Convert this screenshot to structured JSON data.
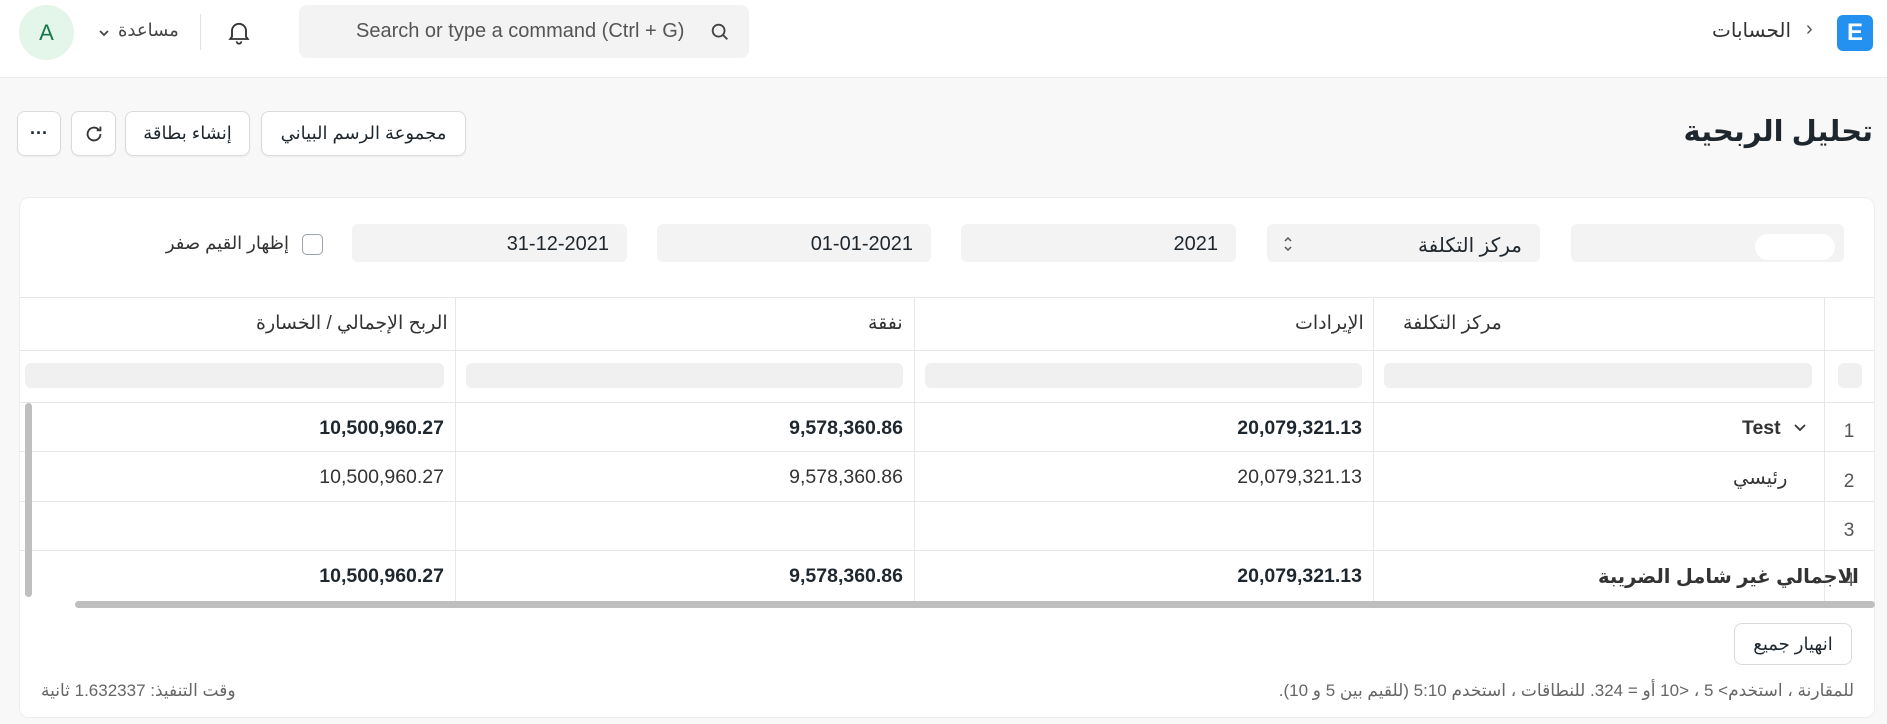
{
  "navbar": {
    "logo_letter": "E",
    "breadcrumb": "الحسابات",
    "search_placeholder": "Search or type a command (Ctrl + G)",
    "help_label": "مساعدة",
    "avatar_letter": "A"
  },
  "page": {
    "title": "تحليل الربحية",
    "buttons": {
      "chart_group": "مجموعة الرسم البياني",
      "create_card": "إنشاء بطاقة",
      "more": "···"
    }
  },
  "filters": {
    "based_on": "مركز التكلفة",
    "fiscal_year": "2021",
    "from_date": "01-01-2021",
    "to_date": "31-12-2021",
    "show_zero_label": "إظهار القيم صفر"
  },
  "table": {
    "columns": [
      "مركز التكلفة",
      "الإيرادات",
      "نفقة",
      "الربح الإجمالي / الخسارة"
    ],
    "rows": [
      {
        "num": "1",
        "cost_center": "Test",
        "income": "20,079,321.13",
        "expense": "9,578,360.86",
        "profit": "10,500,960.27",
        "bold": true
      },
      {
        "num": "2",
        "cost_center": "رئيسي",
        "income": "20,079,321.13",
        "expense": "9,578,360.86",
        "profit": "10,500,960.27",
        "bold": false
      },
      {
        "num": "3",
        "cost_center": "",
        "income": "",
        "expense": "",
        "profit": "",
        "bold": false
      },
      {
        "num": "4",
        "cost_center": "الاجمالي غير شامل الضريبة",
        "income": "20,079,321.13",
        "expense": "9,578,360.86",
        "profit": "10,500,960.27",
        "bold": true
      }
    ]
  },
  "footer": {
    "collapse_all": "انهيار جميع",
    "hint": "للمقارنة ، استخدم> 5 ، <10 أو = 324. للنطاقات ، استخدم 5:10 (للقيم بين 5 و 10).",
    "exec_time": "وقت التنفيذ: 1.632337 ثانية"
  },
  "colors": {
    "accent": "#2490ef",
    "avatar_bg": "#e4f5e9",
    "avatar_fg": "#16794c"
  }
}
